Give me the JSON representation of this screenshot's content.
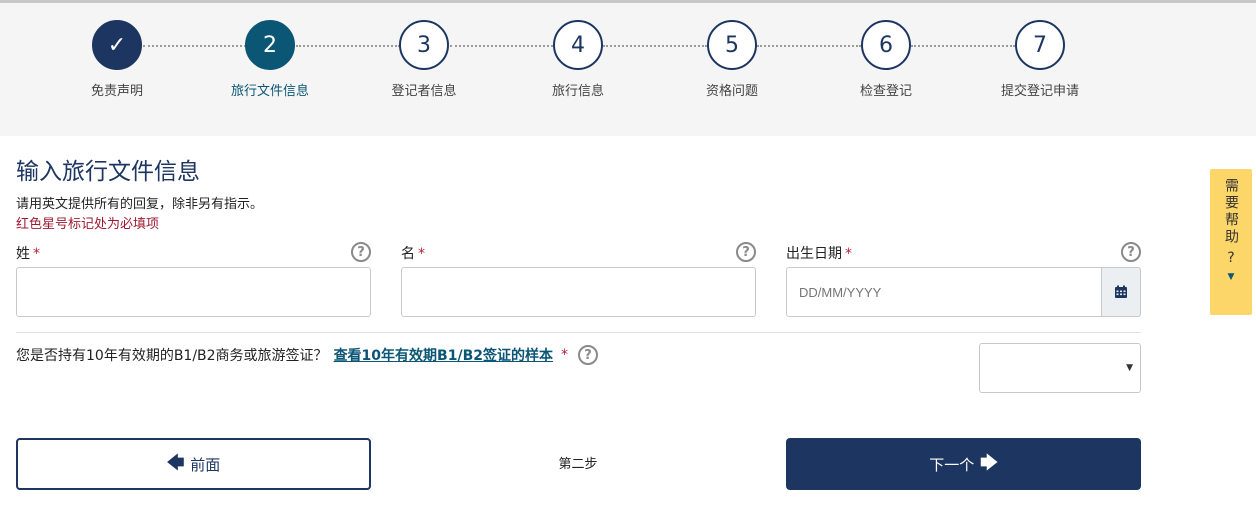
{
  "steps": [
    {
      "symbol": "✓",
      "label": "免责声明",
      "state": "done"
    },
    {
      "symbol": "2",
      "label": "旅行文件信息",
      "state": "active"
    },
    {
      "symbol": "3",
      "label": "登记者信息",
      "state": "pending"
    },
    {
      "symbol": "4",
      "label": "旅行信息",
      "state": "pending"
    },
    {
      "symbol": "5",
      "label": "资格问题",
      "state": "pending"
    },
    {
      "symbol": "6",
      "label": "检查登记",
      "state": "pending"
    },
    {
      "symbol": "7",
      "label": "提交登记申请",
      "state": "pending"
    }
  ],
  "page": {
    "title": "输入旅行文件信息",
    "instruction": "请用英文提供所有的回复，除非另有指示。",
    "required_note": "红色星号标记处为必填项"
  },
  "fields": {
    "surname": {
      "label": "姓",
      "value": ""
    },
    "given_name": {
      "label": "名",
      "value": ""
    },
    "dob": {
      "label": "出生日期",
      "placeholder": "DD/MM/YYYY",
      "value": ""
    }
  },
  "required_marker": "*",
  "help_symbol": "?",
  "visa_question": {
    "text": "您是否持有10年有效期的B1/B2商务或旅游签证？",
    "link": "查看10年有效期B1/B2签证的样本",
    "selected": ""
  },
  "nav": {
    "prev_label": "前面",
    "next_label": "下一个",
    "step_indicator": "第二步"
  },
  "help_tab": {
    "text": "需要帮助",
    "question": "?"
  },
  "icons": {
    "calendar": "calendar-icon",
    "prev_arrow": "arrow-left-icon",
    "next_arrow": "arrow-right-icon",
    "caret": "caret-down-icon"
  },
  "colors": {
    "primary": "#1d3561",
    "active_step": "#0b5675",
    "required": "#b22234",
    "help_tab": "#fcd669"
  }
}
